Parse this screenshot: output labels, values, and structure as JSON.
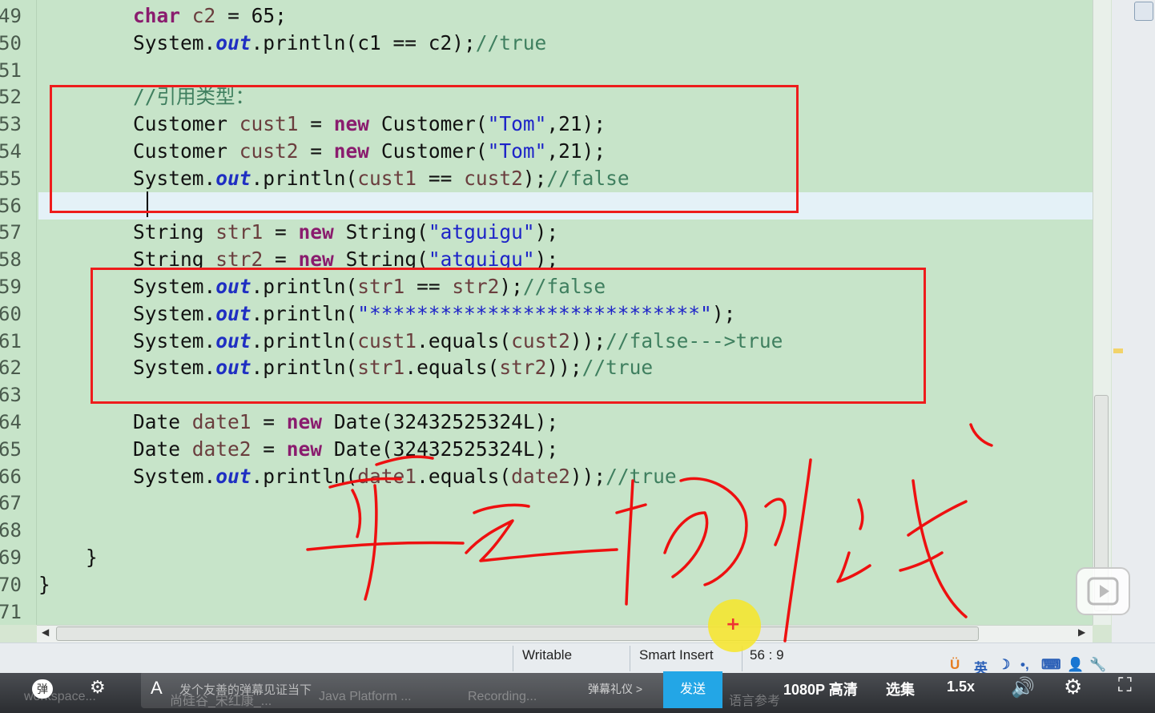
{
  "editor": {
    "lines": [
      {
        "n": "49",
        "segs": [
          [
            "",
            "        "
          ],
          [
            "kw",
            "char"
          ],
          [
            "",
            " "
          ],
          [
            "var",
            "c2"
          ],
          [
            "",
            " = 65;"
          ]
        ]
      },
      {
        "n": "50",
        "segs": [
          [
            "",
            "        System."
          ],
          [
            "fld",
            "out"
          ],
          [
            "",
            ".println(c1 == c2);"
          ],
          [
            "cmt",
            "//true"
          ]
        ]
      },
      {
        "n": "51",
        "segs": [
          [
            "",
            ""
          ]
        ]
      },
      {
        "n": "52",
        "segs": [
          [
            "",
            "        "
          ],
          [
            "cmt",
            "//引用类型："
          ]
        ]
      },
      {
        "n": "53",
        "segs": [
          [
            "",
            "        Customer "
          ],
          [
            "var",
            "cust1"
          ],
          [
            "",
            " = "
          ],
          [
            "kw",
            "new"
          ],
          [
            "",
            " Customer("
          ],
          [
            "str",
            "\"Tom\""
          ],
          [
            "",
            ",21);"
          ]
        ]
      },
      {
        "n": "54",
        "segs": [
          [
            "",
            "        Customer "
          ],
          [
            "var",
            "cust2"
          ],
          [
            "",
            " = "
          ],
          [
            "kw",
            "new"
          ],
          [
            "",
            " Customer("
          ],
          [
            "str",
            "\"Tom\""
          ],
          [
            "",
            ",21);"
          ]
        ]
      },
      {
        "n": "55",
        "segs": [
          [
            "",
            "        System."
          ],
          [
            "fld",
            "out"
          ],
          [
            "",
            ".println("
          ],
          [
            "var",
            "cust1"
          ],
          [
            "",
            " == "
          ],
          [
            "var",
            "cust2"
          ],
          [
            "",
            ");"
          ],
          [
            "cmt",
            "//false"
          ]
        ]
      },
      {
        "n": "56",
        "segs": [
          [
            "",
            ""
          ]
        ],
        "current": true
      },
      {
        "n": "57",
        "segs": [
          [
            "",
            "        String "
          ],
          [
            "var",
            "str1"
          ],
          [
            "",
            " = "
          ],
          [
            "kw",
            "new"
          ],
          [
            "",
            " String("
          ],
          [
            "str",
            "\"atguigu\""
          ],
          [
            "",
            ");"
          ]
        ]
      },
      {
        "n": "58",
        "segs": [
          [
            "",
            "        String "
          ],
          [
            "var",
            "str2"
          ],
          [
            "",
            " = "
          ],
          [
            "kw",
            "new"
          ],
          [
            "",
            " String("
          ],
          [
            "str",
            "\"atguigu\""
          ],
          [
            "",
            ");"
          ]
        ]
      },
      {
        "n": "59",
        "segs": [
          [
            "",
            "        System."
          ],
          [
            "fld",
            "out"
          ],
          [
            "",
            ".println("
          ],
          [
            "var",
            "str1"
          ],
          [
            "",
            " == "
          ],
          [
            "var",
            "str2"
          ],
          [
            "",
            ");"
          ],
          [
            "cmt",
            "//false"
          ]
        ]
      },
      {
        "n": "60",
        "segs": [
          [
            "",
            "        System."
          ],
          [
            "fld",
            "out"
          ],
          [
            "",
            ".println("
          ],
          [
            "str",
            "\"****************************\""
          ],
          [
            "",
            ");"
          ]
        ]
      },
      {
        "n": "61",
        "segs": [
          [
            "",
            "        System."
          ],
          [
            "fld",
            "out"
          ],
          [
            "",
            ".println("
          ],
          [
            "var",
            "cust1"
          ],
          [
            "",
            ".equals("
          ],
          [
            "var",
            "cust2"
          ],
          [
            "",
            "));"
          ],
          [
            "cmt",
            "//false--->true"
          ]
        ]
      },
      {
        "n": "62",
        "segs": [
          [
            "",
            "        System."
          ],
          [
            "fld",
            "out"
          ],
          [
            "",
            ".println("
          ],
          [
            "var",
            "str1"
          ],
          [
            "",
            ".equals("
          ],
          [
            "var",
            "str2"
          ],
          [
            "",
            "));"
          ],
          [
            "cmt",
            "//true"
          ]
        ]
      },
      {
        "n": "63",
        "segs": [
          [
            "",
            ""
          ]
        ]
      },
      {
        "n": "64",
        "segs": [
          [
            "",
            "        Date "
          ],
          [
            "var",
            "date1"
          ],
          [
            "",
            " = "
          ],
          [
            "kw",
            "new"
          ],
          [
            "",
            " Date(32432525324L);"
          ]
        ]
      },
      {
        "n": "65",
        "segs": [
          [
            "",
            "        Date "
          ],
          [
            "var",
            "date2"
          ],
          [
            "",
            " = "
          ],
          [
            "kw",
            "new"
          ],
          [
            "",
            " Date(32432525324L);"
          ]
        ]
      },
      {
        "n": "66",
        "segs": [
          [
            "",
            "        System."
          ],
          [
            "fld",
            "out"
          ],
          [
            "",
            ".println("
          ],
          [
            "var",
            "date1"
          ],
          [
            "",
            ".equals("
          ],
          [
            "var",
            "date2"
          ],
          [
            "",
            "));"
          ],
          [
            "cmt",
            "//true"
          ]
        ]
      },
      {
        "n": "67",
        "segs": [
          [
            "",
            ""
          ]
        ]
      },
      {
        "n": "68",
        "segs": [
          [
            "",
            ""
          ]
        ]
      },
      {
        "n": "69",
        "segs": [
          [
            "",
            "    }"
          ]
        ]
      },
      {
        "n": "70",
        "segs": [
          [
            "",
            "}"
          ]
        ]
      },
      {
        "n": "71",
        "segs": [
          [
            "",
            ""
          ]
        ]
      }
    ]
  },
  "statusbar": {
    "writable": "Writable",
    "insert_mode": "Smart Insert",
    "cursor_pos": "56 : 9"
  },
  "ime": {
    "lang": "英"
  },
  "videobar": {
    "danmu_toggle": "弹",
    "danmu_input_placeholder": "发个友善的弹幕见证当下",
    "danmu_etiquette": "弹幕礼仪 >",
    "send_label": "发送",
    "quality": "1080P 高清",
    "episodes": "选集",
    "speed": "1.5x",
    "taskbar_workspace": "workspace...",
    "taskbar_doc": "尚硅谷_宋红康_...",
    "taskbar_java": "Java Platform ...",
    "taskbar_recording": "Recording...",
    "taskbar_lang": "语言参考"
  },
  "colors": {
    "editor_bg": "#c7e4c9",
    "keyword": "#8a1c6e",
    "string": "#1d23c8",
    "comment": "#3f7f5f",
    "annotation_red": "#ee1c1c",
    "send_button": "#23a6e6"
  }
}
